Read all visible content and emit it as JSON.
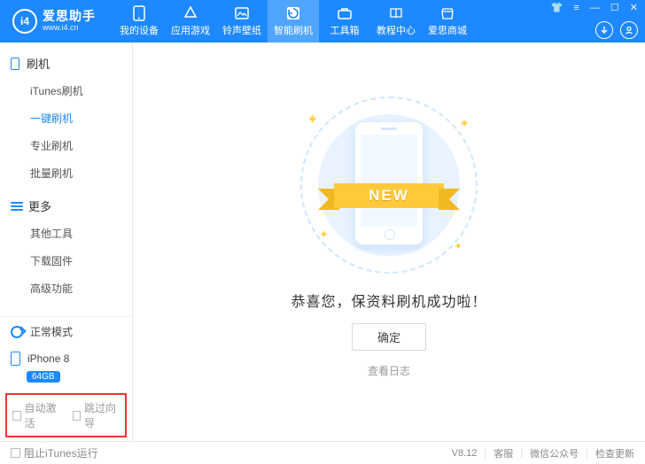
{
  "app": {
    "brand_logo_text": "i4",
    "brand_title": "爱思助手",
    "brand_subtitle": "www.i4.cn"
  },
  "nav": {
    "items": [
      {
        "label": "我的设备"
      },
      {
        "label": "应用游戏"
      },
      {
        "label": "铃声壁纸"
      },
      {
        "label": "智能刷机",
        "active": true
      },
      {
        "label": "工具箱"
      },
      {
        "label": "教程中心"
      },
      {
        "label": "爱思商城"
      }
    ]
  },
  "sidebar": {
    "sections": [
      {
        "title": "刷机",
        "items": [
          "iTunes刷机",
          "一键刷机",
          "专业刷机",
          "批量刷机"
        ],
        "active_index": 1
      },
      {
        "title": "更多",
        "items": [
          "其他工具",
          "下载固件",
          "高级功能"
        ]
      }
    ],
    "mode_label": "正常模式",
    "device_name": "iPhone 8",
    "device_storage": "64GB",
    "checks": {
      "auto_activate": "自动激活",
      "skip_guide": "跳过向导"
    }
  },
  "main": {
    "ribbon_text": "NEW",
    "success_text": "恭喜您，保资料刷机成功啦！",
    "ok_button": "确定",
    "view_log": "查看日志"
  },
  "footer": {
    "block_itunes": "阻止iTunes运行",
    "version": "V8.12",
    "links": [
      "客服",
      "微信公众号",
      "检查更新"
    ]
  }
}
